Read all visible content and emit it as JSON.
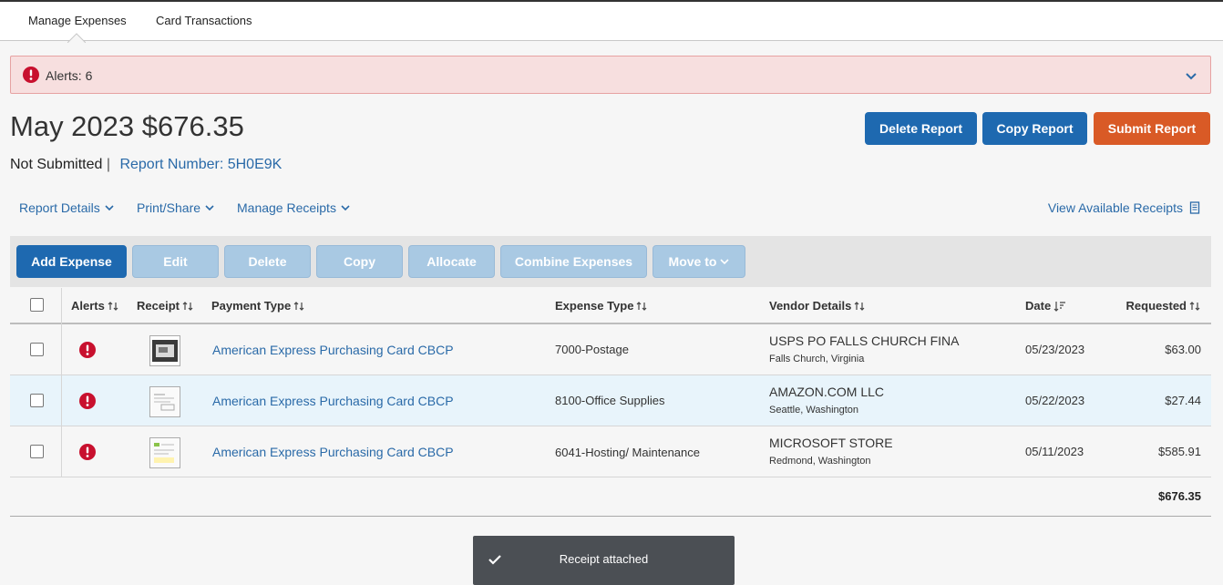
{
  "tabs": [
    "Manage Expenses",
    "Card Transactions"
  ],
  "alerts": {
    "label": "Alerts: 6"
  },
  "report": {
    "title": "May 2023 $676.35",
    "status": "Not Submitted",
    "separator": "|",
    "number_label": "Report Number: 5H0E9K"
  },
  "header_buttons": {
    "delete": "Delete Report",
    "copy": "Copy Report",
    "submit": "Submit Report"
  },
  "menus": {
    "report_details": "Report Details",
    "print_share": "Print/Share",
    "manage_receipts": "Manage Receipts",
    "view_receipts": "View Available Receipts"
  },
  "toolbar": {
    "add": "Add Expense",
    "edit": "Edit",
    "delete": "Delete",
    "copy": "Copy",
    "allocate": "Allocate",
    "combine": "Combine Expenses",
    "move": "Move to"
  },
  "columns": [
    "Alerts",
    "Receipt",
    "Payment Type",
    "Expense Type",
    "Vendor Details",
    "Date",
    "Requested"
  ],
  "rows": [
    {
      "payment_type": "American Express Purchasing Card CBCP",
      "expense_type": "7000-Postage",
      "vendor": "USPS PO FALLS CHURCH FINA",
      "location": "Falls Church, Virginia",
      "date": "05/23/2023",
      "amount": "$63.00"
    },
    {
      "payment_type": "American Express Purchasing Card CBCP",
      "expense_type": "8100-Office Supplies",
      "vendor": "AMAZON.COM LLC",
      "location": "Seattle, Washington",
      "date": "05/22/2023",
      "amount": "$27.44"
    },
    {
      "payment_type": "American Express Purchasing Card CBCP",
      "expense_type": "6041-Hosting/ Maintenance",
      "vendor": "MICROSOFT STORE",
      "location": "Redmond, Washington",
      "date": "05/11/2023",
      "amount": "$585.91"
    }
  ],
  "total": "$676.35",
  "toast": "Receipt attached",
  "colors": {
    "primary": "#1e69b0",
    "submit": "#d95a26",
    "alert_red": "#c8102e",
    "link": "#2a6aa8"
  }
}
